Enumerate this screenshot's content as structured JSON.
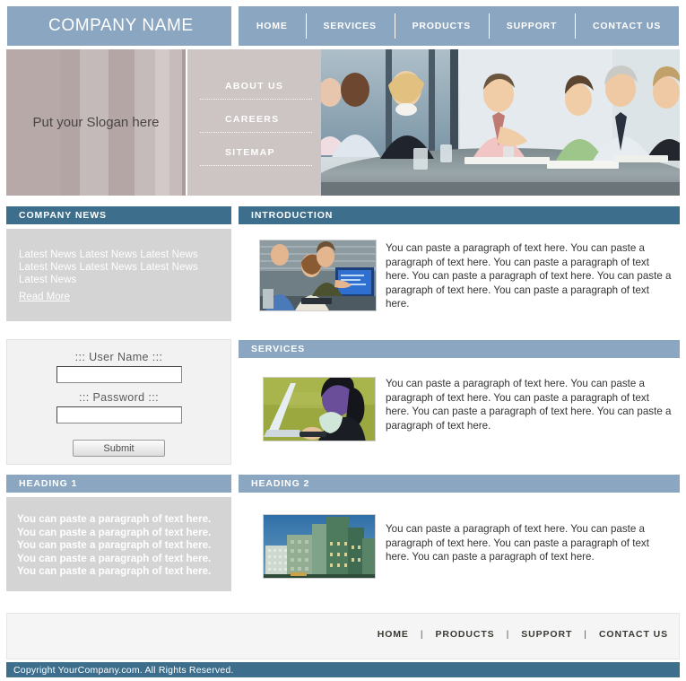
{
  "header": {
    "company_name": "COMPANY NAME",
    "nav": [
      {
        "label": "HOME"
      },
      {
        "label": "SERVICES"
      },
      {
        "label": "PRODUCTS"
      },
      {
        "label": "SUPPORT"
      },
      {
        "label": "CONTACT US"
      }
    ]
  },
  "banner": {
    "slogan": "Put your Slogan here",
    "side_links": [
      {
        "label": "ABOUT US"
      },
      {
        "label": "CAREERS"
      },
      {
        "label": "SITEMAP"
      }
    ],
    "photo_alt": "boardroom-meeting-photo"
  },
  "sidebar": {
    "news": {
      "heading": "COMPANY NEWS",
      "body": "Latest News  Latest News  Latest News  Latest News  Latest News Latest News Latest News",
      "read_more": "Read More"
    },
    "login": {
      "username_label": "::: User Name :::",
      "username_value": "",
      "username_placeholder": "",
      "password_label": "::: Password :::",
      "password_value": "",
      "password_placeholder": "",
      "submit_label": "Submit"
    },
    "heading1": {
      "heading": "HEADING 1",
      "body": "You can paste a paragraph of text here. You can paste a paragraph of text here. You can paste a paragraph of text here. You can paste a paragraph of text here. You can paste a paragraph of text here."
    }
  },
  "main": {
    "introduction": {
      "heading": "INTRODUCTION",
      "image_alt": "office-workers-at-computer-photo",
      "body": "You can paste a paragraph of text here. You can paste a paragraph of text here. You can paste a paragraph of text here. You can paste a paragraph of text here. You can paste a paragraph of text here. You can paste a paragraph of text here."
    },
    "services": {
      "heading": "SERVICES",
      "image_alt": "person-using-laptop-photo",
      "body": "You can paste a paragraph of text here. You can paste a paragraph of text here. You can paste a paragraph of text here. You can paste a paragraph of text here. You can paste a paragraph of text here."
    },
    "heading2": {
      "heading": "HEADING 2",
      "image_alt": "city-skyscrapers-photo",
      "body": "You can paste a paragraph of text here. You can paste a paragraph of text here. You can paste a paragraph of text here. You can paste a paragraph of text here."
    }
  },
  "footer": {
    "nav": [
      {
        "label": "HOME"
      },
      {
        "label": "PRODUCTS"
      },
      {
        "label": "SUPPORT"
      },
      {
        "label": "CONTACT US"
      }
    ],
    "separator": "|",
    "copyright": "Copyright YourCompany.com. All Rights Reserved."
  },
  "colors": {
    "accent_dark": "#3d6e8c",
    "accent_light": "#8ba6c0",
    "panel_gray": "#d4d4d4",
    "slogan_bg": "#b6a9a8",
    "links_bg": "#cdc5c4"
  }
}
